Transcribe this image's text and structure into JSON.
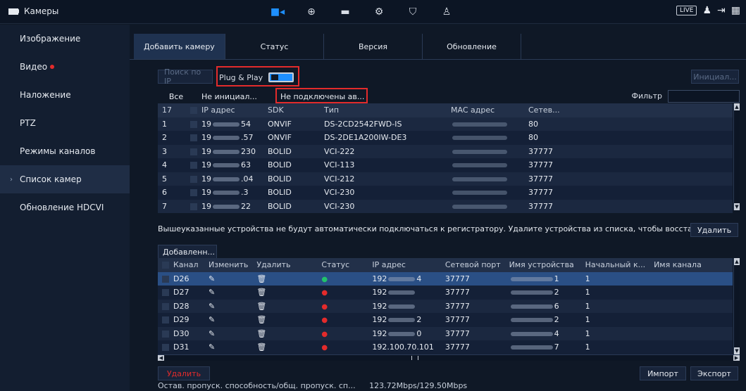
{
  "app": {
    "title": "Камеры"
  },
  "topbar": {
    "live_label": "LIVE",
    "nav": [
      "camera-icon",
      "globe-icon",
      "storage-icon",
      "settings-icon",
      "shield-icon",
      "account-settings-icon"
    ]
  },
  "sidebar": {
    "items": [
      {
        "label": "Изображение"
      },
      {
        "label": "Видео"
      },
      {
        "label": "Наложение"
      },
      {
        "label": "PTZ"
      },
      {
        "label": "Режимы каналов"
      },
      {
        "label": "Список камер"
      },
      {
        "label": "Обновление HDCVI"
      }
    ]
  },
  "tabs": [
    {
      "label": "Добавить камеру"
    },
    {
      "label": "Статус"
    },
    {
      "label": "Версия"
    },
    {
      "label": "Обновление"
    }
  ],
  "search": {
    "button": "Поиск по IP",
    "plug_play": "Plug & Play",
    "init_button": "Инициал..."
  },
  "filter": {
    "all": "Все",
    "uninit": "Не инициал...",
    "not_connected": "Не подключены ав...",
    "label": "Фильтр"
  },
  "devices": {
    "headers": [
      "17",
      "IP адрес",
      "SDK",
      "Тип",
      "MAC адрес",
      "Сетев..."
    ],
    "rows": [
      {
        "num": "1",
        "ip_prefix": "19",
        "ip_suffix": "54",
        "sdk": "ONVIF",
        "type": "DS-2CD2542FWD-IS",
        "port": "80"
      },
      {
        "num": "2",
        "ip_prefix": "19",
        "ip_suffix": ".57",
        "sdk": "ONVIF",
        "type": "DS-2DE1A200IW-DE3",
        "port": "80"
      },
      {
        "num": "3",
        "ip_prefix": "19",
        "ip_suffix": "230",
        "sdk": "BOLID",
        "type": "VCI-222",
        "port": "37777"
      },
      {
        "num": "4",
        "ip_prefix": "19",
        "ip_suffix": "63",
        "sdk": "BOLID",
        "type": "VCI-113",
        "port": "37777"
      },
      {
        "num": "5",
        "ip_prefix": "19",
        "ip_suffix": ".04",
        "sdk": "BOLID",
        "type": "VCI-212",
        "port": "37777"
      },
      {
        "num": "6",
        "ip_prefix": "19",
        "ip_suffix": ".3",
        "sdk": "BOLID",
        "type": "VCI-230",
        "port": "37777"
      },
      {
        "num": "7",
        "ip_prefix": "19",
        "ip_suffix": "22",
        "sdk": "BOLID",
        "type": "VCI-230",
        "port": "37777"
      }
    ]
  },
  "notice": {
    "text": "Вышеуказанные устройства не будут автоматически подключаться к регистратору. Удалите устройства из списка, чтобы восстанов...",
    "delete_button": "Удалить"
  },
  "added": {
    "dropdown": "Добавленн...",
    "headers": [
      "Канал",
      "Изменить",
      "Удалить",
      "Статус",
      "IP адрес",
      "Сетевой порт",
      "Имя устройства",
      "Начальный к...",
      "Имя канала"
    ],
    "rows": [
      {
        "channel": "D26",
        "status": "online",
        "ip_prefix": "192",
        "ip_suffix": "4",
        "port": "37777",
        "name_suffix": "1",
        "start": "1"
      },
      {
        "channel": "D27",
        "status": "offline",
        "ip_prefix": "192",
        "ip_suffix": "",
        "port": "37777",
        "name_suffix": "2",
        "start": "1"
      },
      {
        "channel": "D28",
        "status": "offline",
        "ip_prefix": "192",
        "ip_suffix": "",
        "port": "37777",
        "name_suffix": "6",
        "start": "1"
      },
      {
        "channel": "D29",
        "status": "offline",
        "ip_prefix": "192",
        "ip_suffix": "2",
        "port": "37777",
        "name_suffix": "2",
        "start": "1"
      },
      {
        "channel": "D30",
        "status": "offline",
        "ip_prefix": "192",
        "ip_suffix": "0",
        "port": "37777",
        "name_suffix": "4",
        "start": "1"
      },
      {
        "channel": "D31",
        "status": "offline",
        "ip_prefix": "192.100.70.101",
        "ip_suffix": "",
        "port": "37777",
        "name_suffix": "7",
        "start": "1"
      }
    ],
    "delete_button": "Удалить",
    "import_button": "Импорт",
    "export_button": "Экспорт"
  },
  "footer": {
    "bandwidth_label": "Остав. пропуск. способность/общ. пропуск. сп...",
    "bandwidth_value": "123.72Mbps/129.50Mbps"
  },
  "colors": {
    "accent": "#1e8fff",
    "highlight": "#e32b2b",
    "online": "#21c26b",
    "selected_row": "#2a4f85"
  }
}
